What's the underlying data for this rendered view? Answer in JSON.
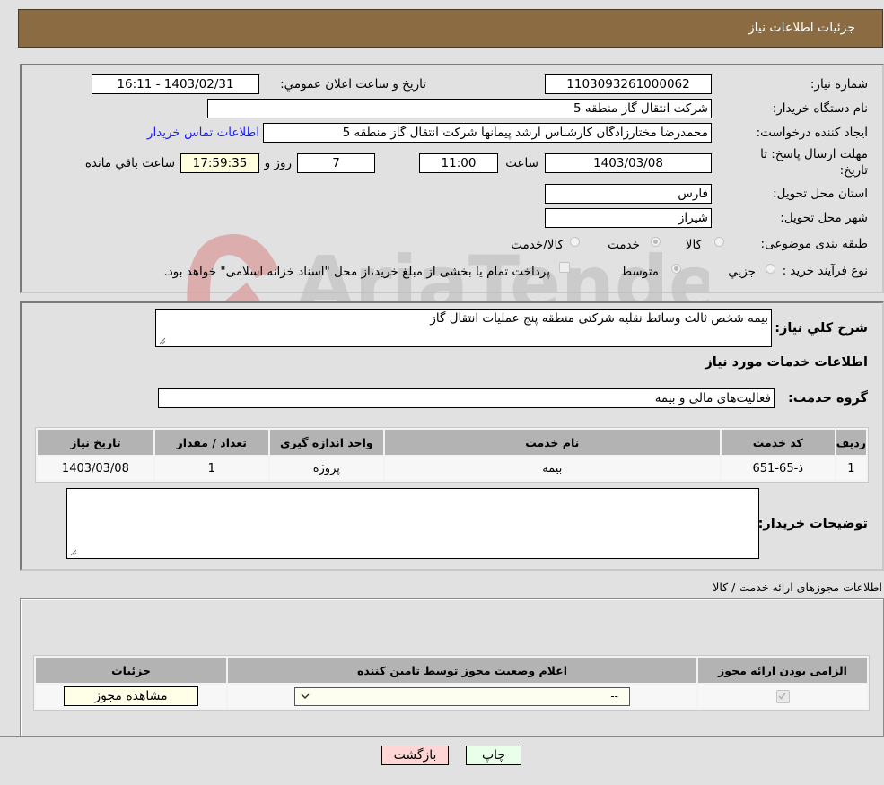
{
  "header": {
    "title": "جزئیات اطلاعات نیاز"
  },
  "details": {
    "need_number": {
      "label": "شماره نیاز:",
      "value": "1103093261000062"
    },
    "announce_datetime": {
      "label": "تاریخ و ساعت اعلان عمومي:",
      "value": "1403/02/31 - 16:11"
    },
    "buyer_org": {
      "label": "نام دستگاه خریدار:",
      "value": "شرکت انتقال گاز منطقه 5"
    },
    "requester": {
      "label": "ایجاد کننده درخواست:",
      "value": "محمدرضا  مختارزادگان کارشناس ارشد پیمانها شرکت انتقال گاز منطقه 5"
    },
    "buyer_contact_link": "اطلاعات تماس خریدار",
    "deadline": {
      "label_line1": "مهلت ارسال پاسخ: تا",
      "label_line2": "تاریخ:",
      "date": "1403/03/08",
      "time_label": "ساعت",
      "time": "11:00",
      "days": "7",
      "days_label": "روز و",
      "remaining": "17:59:35",
      "remaining_label": "ساعت باقي مانده"
    },
    "province": {
      "label": "استان محل تحویل:",
      "value": "فارس"
    },
    "city": {
      "label": "شهر محل تحویل:",
      "value": "شیراز"
    },
    "category": {
      "label": "طبقه بندی موضوعی:",
      "options": [
        {
          "label": "کالا",
          "checked": false
        },
        {
          "label": "خدمت",
          "checked": true
        },
        {
          "label": "کالا/خدمت",
          "checked": false
        }
      ]
    },
    "purchase_process": {
      "label": "نوع فرآیند خرید :",
      "options": [
        {
          "label": "جزيي",
          "checked": false
        },
        {
          "label": "متوسط",
          "checked": true
        }
      ],
      "treasury_checkbox_label": "پرداخت تمام یا بخشی از مبلغ خرید،از محل \"اسناد خزانه اسلامی\" خواهد بود.",
      "treasury_checked": false
    }
  },
  "description": {
    "label": "شرح کلي نیاز:",
    "value": "بیمه شخص ثالث وسائط نقلیه شرکتی منطقه پنج عملیات انتقال گاز"
  },
  "services": {
    "section_title": "اطلاعات خدمات مورد نیاز",
    "group_label": "گروه خدمت:",
    "group_value": "فعالیت‌های مالی و بیمه",
    "columns": [
      "ردیف",
      "کد خدمت",
      "نام خدمت",
      "واحد اندازه گیری",
      "تعداد / مقدار",
      "تاریخ نیاز"
    ],
    "rows": [
      [
        "1",
        "ذ-65-651",
        "بیمه",
        "پروژه",
        "1",
        "1403/03/08"
      ]
    ]
  },
  "buyer_notes": {
    "label": "توضیحات خریدار:",
    "value": ""
  },
  "permits": {
    "section_title": "اطلاعات مجوزهای ارائه خدمت / کالا",
    "columns": [
      "الزامی بودن ارائه مجوز",
      "اعلام وضعیت مجوز توسط تامین کننده",
      "جزئیات"
    ],
    "rows": [
      {
        "required": true,
        "status_selected": "--",
        "details_button": "مشاهده مجوز"
      }
    ]
  },
  "actions": {
    "print": "چاپ",
    "back": "بازگشت"
  },
  "watermark": {
    "text": "AriaTender.neT"
  },
  "colors": {
    "header_bg": "#8b6c42",
    "link": "#1a1aff",
    "back_btn": "#ffd6d6",
    "print_btn": "#eaffea"
  }
}
